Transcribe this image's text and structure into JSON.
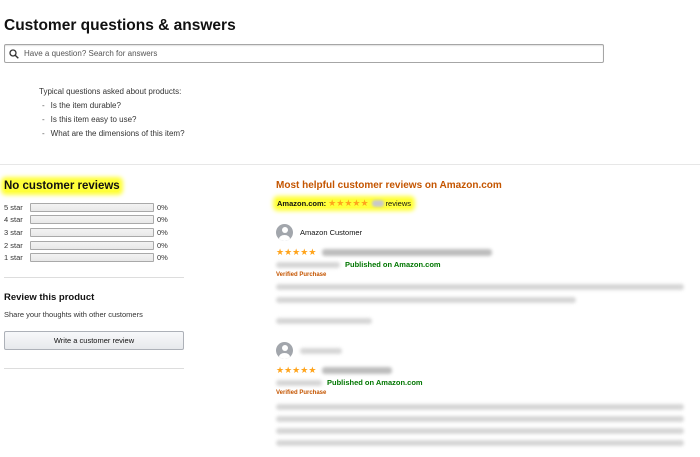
{
  "qa": {
    "title": "Customer questions & answers",
    "search_placeholder": "Have a question? Search for answers",
    "typical_lead": "Typical questions asked about products:",
    "typical_questions": [
      "Is the item durable?",
      "Is this item easy to use?",
      "What are the dimensions of this item?"
    ]
  },
  "ratings": {
    "title": "No customer reviews",
    "rows": [
      {
        "label": "5 star",
        "percent": "0%",
        "fill": 0
      },
      {
        "label": "4 star",
        "percent": "0%",
        "fill": 0
      },
      {
        "label": "3 star",
        "percent": "0%",
        "fill": 0
      },
      {
        "label": "2 star",
        "percent": "0%",
        "fill": 0
      },
      {
        "label": "1 star",
        "percent": "0%",
        "fill": 0
      }
    ]
  },
  "review_product": {
    "title": "Review this product",
    "subtitle": "Share your thoughts with other customers",
    "button": "Write a customer review"
  },
  "helpful": {
    "title": "Most helpful customer reviews on Amazon.com",
    "site_label": "Amazon.com:",
    "reviews_word": "reviews",
    "rating_stars": 5,
    "reviews": [
      {
        "author": "Amazon Customer",
        "stars": 5,
        "published": "Published on Amazon.com",
        "verified": "Verified Purchase"
      },
      {
        "author": "",
        "stars": 5,
        "published": "Published on Amazon.com",
        "verified": "Verified Purchase"
      }
    ]
  },
  "colors": {
    "highlight": "#ffff3a",
    "star": "#ffa41c",
    "link_orange": "#c45500",
    "published_green": "#007600"
  }
}
